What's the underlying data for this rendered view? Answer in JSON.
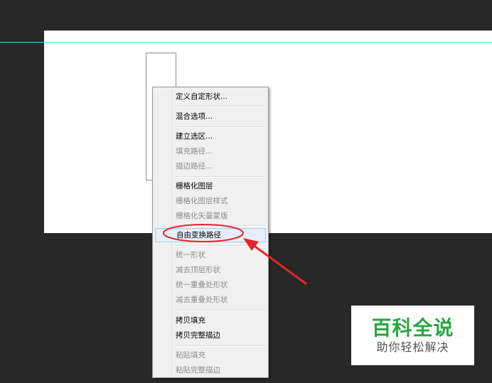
{
  "context_menu": {
    "items": [
      {
        "label": "定义自定形状...",
        "enabled": true
      },
      {
        "label": "混合选项...",
        "enabled": true
      },
      {
        "label": "建立选区...",
        "enabled": true
      },
      {
        "label": "填充路径...",
        "enabled": false
      },
      {
        "label": "描边路径...",
        "enabled": false
      },
      {
        "label": "栅格化图层",
        "enabled": true
      },
      {
        "label": "栅格化图层样式",
        "enabled": false
      },
      {
        "label": "栅格化矢量蒙版",
        "enabled": false
      },
      {
        "label": "自由变换路径",
        "enabled": true,
        "highlighted": true
      },
      {
        "label": "统一形状",
        "enabled": false
      },
      {
        "label": "减去顶层形状",
        "enabled": false
      },
      {
        "label": "统一重叠处形状",
        "enabled": false
      },
      {
        "label": "减去重叠处形状",
        "enabled": false
      },
      {
        "label": "拷贝填充",
        "enabled": true
      },
      {
        "label": "拷贝完整描边",
        "enabled": true
      },
      {
        "label": "粘贴填充",
        "enabled": false
      },
      {
        "label": "粘贴完整描边",
        "enabled": false
      }
    ]
  },
  "annotation": {
    "color": "#e0262b"
  },
  "watermark": {
    "brand": "百科全说",
    "tagline": "助你轻松解决",
    "brand_color": "#2aa541"
  },
  "colors": {
    "workspace": "#282828",
    "guide": "#4fd7e0",
    "menu_bg": "#f0f0f0",
    "highlight": "#e5eff9"
  }
}
